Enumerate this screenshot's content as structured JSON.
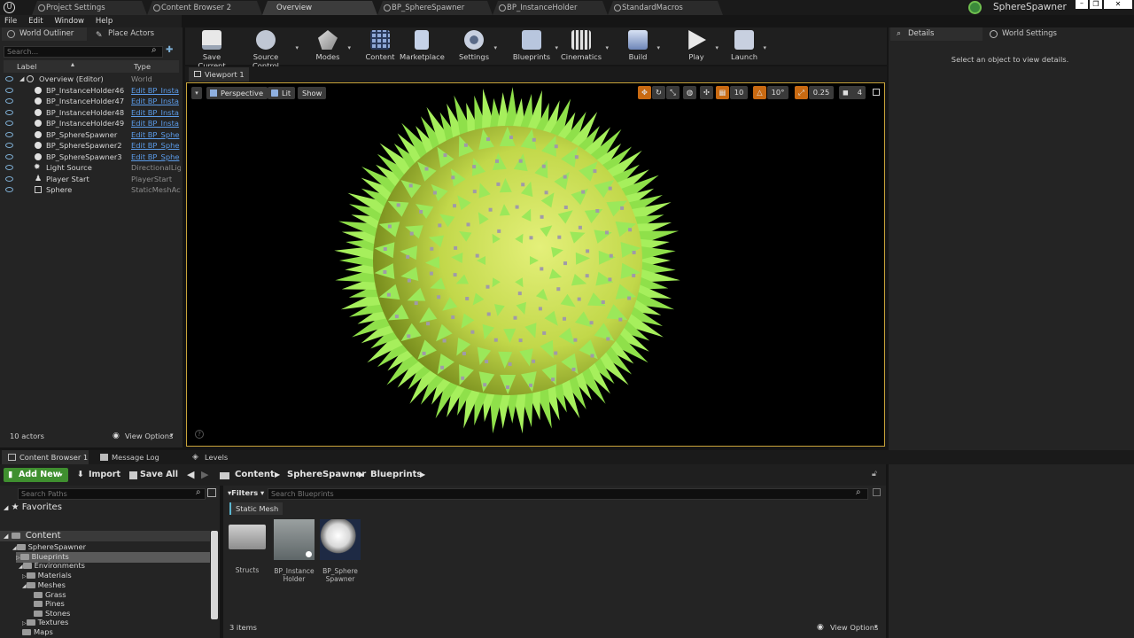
{
  "app": {
    "title": "SphereSpawner",
    "window_controls": [
      "minimize",
      "restore",
      "close"
    ]
  },
  "tabs": [
    {
      "label": "Project Settings",
      "active": false
    },
    {
      "label": "Content Browser 2",
      "active": false
    },
    {
      "label": "Overview",
      "active": true
    },
    {
      "label": "BP_SphereSpawner",
      "active": false
    },
    {
      "label": "BP_InstanceHolder",
      "active": false
    },
    {
      "label": "StandardMacros",
      "active": false
    }
  ],
  "menu": [
    "File",
    "Edit",
    "Window",
    "Help"
  ],
  "outliner": {
    "tab": "World Outliner",
    "tab2": "Place Actors",
    "search_placeholder": "Search...",
    "col_label": "Label",
    "col_type": "Type",
    "rows": [
      {
        "label": "Overview (Editor)",
        "type": "World",
        "link": false
      },
      {
        "label": "BP_InstanceHolder46",
        "type": "Edit BP_Insta",
        "link": true
      },
      {
        "label": "BP_InstanceHolder47",
        "type": "Edit BP_Insta",
        "link": true
      },
      {
        "label": "BP_InstanceHolder48",
        "type": "Edit BP_Insta",
        "link": true
      },
      {
        "label": "BP_InstanceHolder49",
        "type": "Edit BP_Insta",
        "link": true
      },
      {
        "label": "BP_SphereSpawner",
        "type": "Edit BP_Sphe",
        "link": true
      },
      {
        "label": "BP_SphereSpawner2",
        "type": "Edit BP_Sphe",
        "link": true
      },
      {
        "label": "BP_SphereSpawner3",
        "type": "Edit BP_Sphe",
        "link": true
      },
      {
        "label": "Light Source",
        "type": "DirectionalLig",
        "link": false
      },
      {
        "label": "Player Start",
        "type": "PlayerStart",
        "link": false
      },
      {
        "label": "Sphere",
        "type": "StaticMeshAct",
        "link": false
      }
    ],
    "count": "10 actors",
    "view_options": "View Options"
  },
  "toolbar": [
    {
      "label": "Save Current",
      "icon": "save-icon"
    },
    {
      "label": "Source Control",
      "icon": "source-control-icon"
    },
    {
      "label": "Modes",
      "icon": "modes-icon"
    },
    {
      "label": "Content",
      "icon": "content-icon"
    },
    {
      "label": "Marketplace",
      "icon": "marketplace-icon"
    },
    {
      "label": "Settings",
      "icon": "settings-icon"
    },
    {
      "label": "Blueprints",
      "icon": "blueprints-icon"
    },
    {
      "label": "Cinematics",
      "icon": "cinematics-icon"
    },
    {
      "label": "Build",
      "icon": "build-icon"
    },
    {
      "label": "Play",
      "icon": "play-icon"
    },
    {
      "label": "Launch",
      "icon": "launch-icon"
    }
  ],
  "viewport": {
    "tab": "Viewport 1",
    "perspective": "Perspective",
    "lit": "Lit",
    "show": "Show",
    "grid_snap": "10",
    "rot_snap": "10°",
    "scale_snap": "0.25",
    "cam_speed": "4"
  },
  "details": {
    "tab": "Details",
    "tab2": "World Settings",
    "empty_message": "Select an object to view details."
  },
  "bottom_tabs": [
    "Content Browser 1",
    "Message Log",
    "Levels"
  ],
  "content_browser": {
    "add_new": "Add New",
    "import": "Import",
    "save_all": "Save All",
    "breadcrumb": [
      "Content",
      "SphereSpawner",
      "Blueprints"
    ],
    "search_paths_placeholder": "Search Paths",
    "filters": "Filters",
    "search_placeholder": "Search Blueprints",
    "filter_chip": "Static Mesh",
    "favorites": "Favorites",
    "tree": [
      {
        "label": "Content",
        "depth": 0
      },
      {
        "label": "SphereSpawner",
        "depth": 1
      },
      {
        "label": "Blueprints",
        "depth": 2
      },
      {
        "label": "Environments",
        "depth": 2
      },
      {
        "label": "Materials",
        "depth": 3
      },
      {
        "label": "Meshes",
        "depth": 3
      },
      {
        "label": "Grass",
        "depth": 4
      },
      {
        "label": "Pines",
        "depth": 4
      },
      {
        "label": "Stones",
        "depth": 4
      },
      {
        "label": "Textures",
        "depth": 3
      },
      {
        "label": "Maps",
        "depth": 2
      }
    ],
    "assets": [
      {
        "label": "Structs"
      },
      {
        "label": "BP_Instance Holder"
      },
      {
        "label": "BP_Sphere Spawner"
      }
    ],
    "item_count": "3 items",
    "view_options": "View Options"
  },
  "colors": {
    "accent": "#c9a43a",
    "link": "#5b9be8",
    "green": "#4caf50",
    "sphere": "#c8e04a"
  }
}
